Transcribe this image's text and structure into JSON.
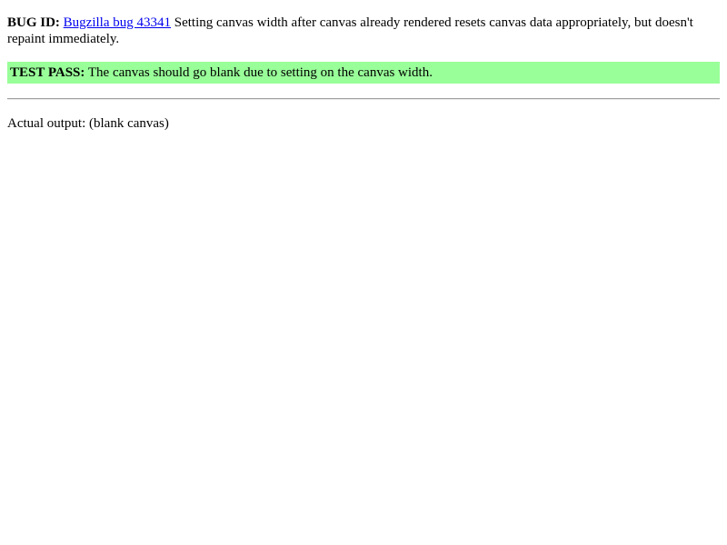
{
  "bug": {
    "label": "BUG ID:",
    "link_text": "Bugzilla bug 43341",
    "description": "Setting canvas width after canvas already rendered resets canvas data appropriately, but doesn't repaint immediately."
  },
  "test_result": {
    "label": "TEST PASS:",
    "message": "The canvas should go blank due to setting on the canvas width.",
    "background_color": "#99ff99"
  },
  "output": {
    "label": "Actual output:",
    "value": "(blank canvas)"
  },
  "colors": {
    "link": "#0000ee",
    "text": "#000000",
    "background": "#ffffff"
  }
}
